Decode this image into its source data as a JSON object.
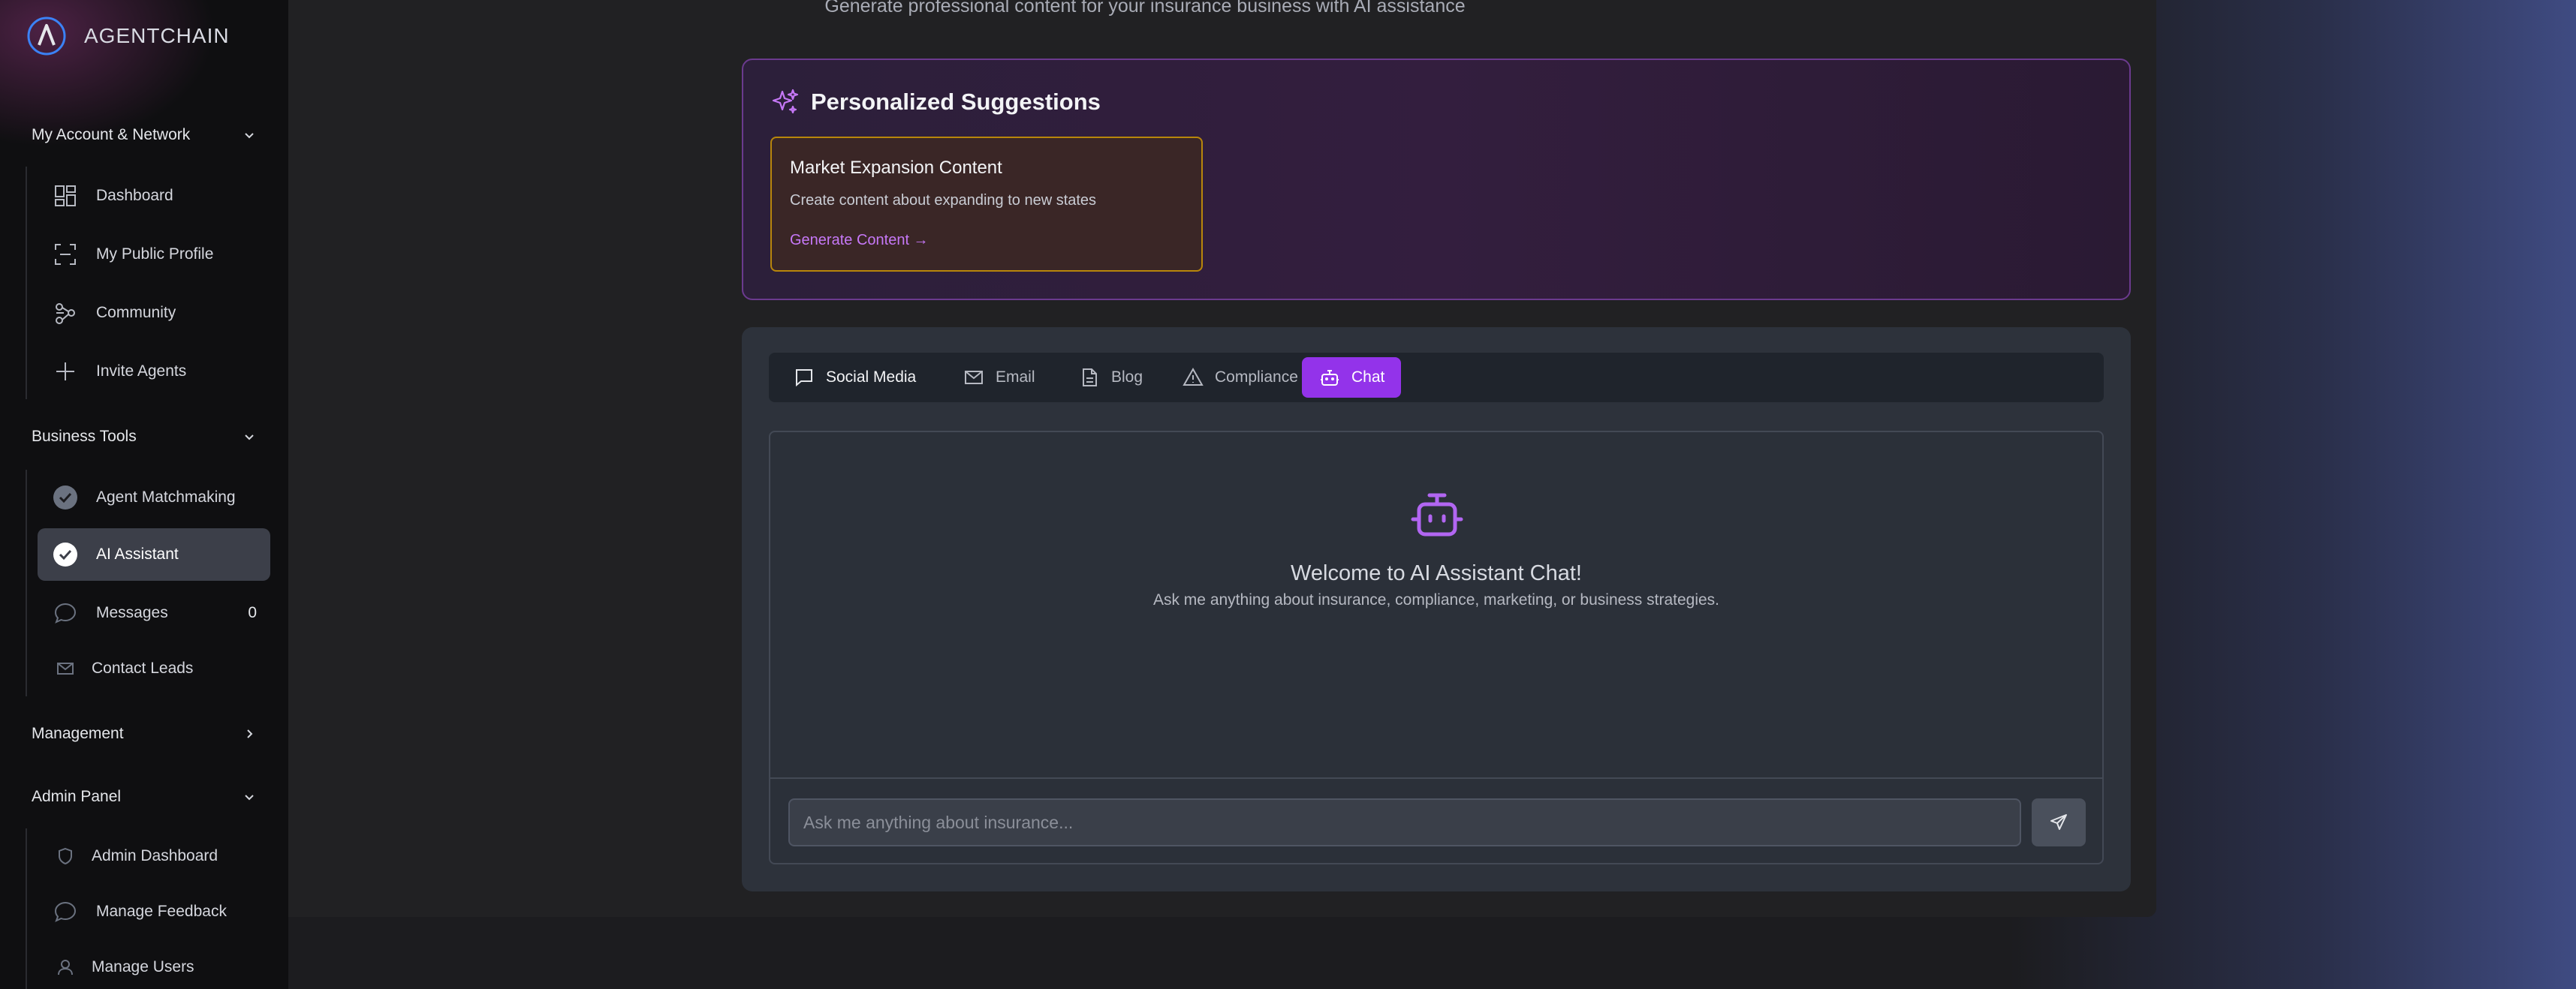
{
  "brand": {
    "name": "AGENTCHAIN",
    "accent": "#9333ea"
  },
  "sidebar": {
    "sections": [
      {
        "title": "My Account & Network",
        "expanded": true,
        "items": [
          {
            "label": "Dashboard",
            "icon": "dashboard-grid-icon"
          },
          {
            "label": "My Public Profile",
            "icon": "scan-frame-icon"
          },
          {
            "label": "Community",
            "icon": "network-icon"
          },
          {
            "label": "Invite Agents",
            "icon": "plus-icon"
          }
        ]
      },
      {
        "title": "Business Tools",
        "expanded": true,
        "items": [
          {
            "label": "Agent Matchmaking",
            "icon": "check-circle-icon"
          },
          {
            "label": "AI Assistant",
            "icon": "check-circle-icon",
            "active": true
          },
          {
            "label": "Messages",
            "icon": "message-bubble-icon",
            "badge": "0"
          },
          {
            "label": "Contact Leads",
            "icon": "mail-icon"
          }
        ]
      },
      {
        "title": "Management",
        "expanded": false,
        "items": []
      },
      {
        "title": "Admin Panel",
        "expanded": true,
        "items": [
          {
            "label": "Admin Dashboard",
            "icon": "shield-icon"
          },
          {
            "label": "Manage Feedback",
            "icon": "message-bubble-icon"
          },
          {
            "label": "Manage Users",
            "icon": "user-icon"
          }
        ]
      }
    ]
  },
  "main": {
    "subtitle": "Generate professional content for your insurance business with AI assistance",
    "suggestions": {
      "title": "Personalized Suggestions",
      "items": [
        {
          "title": "Market Expansion Content",
          "description": "Create content about expanding to new states",
          "action": "Generate Content →"
        }
      ]
    },
    "tabs": [
      {
        "label": "Social Media",
        "icon": "message-square-icon"
      },
      {
        "label": "Email",
        "icon": "mail-icon"
      },
      {
        "label": "Blog",
        "icon": "document-icon"
      },
      {
        "label": "Compliance",
        "icon": "warning-triangle-icon"
      },
      {
        "label": "Chat",
        "icon": "robot-icon",
        "active": true
      }
    ],
    "chat": {
      "welcome_title": "Welcome to AI Assistant Chat!",
      "welcome_subtitle": "Ask me anything about insurance, compliance, marketing, or business strategies.",
      "input_placeholder": "Ask me anything about insurance...",
      "input_value": ""
    }
  }
}
